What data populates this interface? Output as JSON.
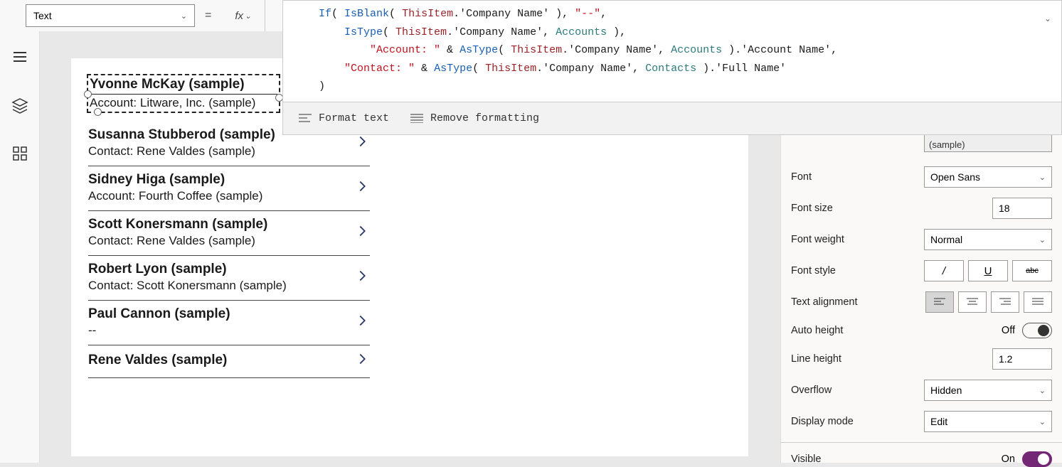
{
  "propertyDropdown": "Text",
  "fx": "fx",
  "formula": {
    "tokens": [
      [
        {
          "t": "If",
          "c": "tok-blue"
        },
        {
          "t": "( ",
          "c": "tok-text"
        },
        {
          "t": "IsBlank",
          "c": "tok-blue"
        },
        {
          "t": "( ",
          "c": "tok-text"
        },
        {
          "t": "ThisItem",
          "c": "tok-darkred"
        },
        {
          "t": ".'Company Name' ), ",
          "c": "tok-text"
        },
        {
          "t": "\"--\"",
          "c": "tok-red"
        },
        {
          "t": ",",
          "c": "tok-text"
        }
      ],
      [
        {
          "t": "    ",
          "c": "tok-text"
        },
        {
          "t": "IsType",
          "c": "tok-blue"
        },
        {
          "t": "( ",
          "c": "tok-text"
        },
        {
          "t": "ThisItem",
          "c": "tok-darkred"
        },
        {
          "t": ".'Company Name', ",
          "c": "tok-text"
        },
        {
          "t": "Accounts",
          "c": "tok-teal"
        },
        {
          "t": " ),",
          "c": "tok-text"
        }
      ],
      [
        {
          "t": "        ",
          "c": "tok-text"
        },
        {
          "t": "\"Account: \"",
          "c": "tok-red"
        },
        {
          "t": " & ",
          "c": "tok-text"
        },
        {
          "t": "AsType",
          "c": "tok-blue"
        },
        {
          "t": "( ",
          "c": "tok-text"
        },
        {
          "t": "ThisItem",
          "c": "tok-darkred"
        },
        {
          "t": ".'Company Name', ",
          "c": "tok-text"
        },
        {
          "t": "Accounts",
          "c": "tok-teal"
        },
        {
          "t": " ).'Account Name',",
          "c": "tok-text"
        }
      ],
      [
        {
          "t": "    ",
          "c": "tok-text"
        },
        {
          "t": "\"Contact: \"",
          "c": "tok-red"
        },
        {
          "t": " & ",
          "c": "tok-text"
        },
        {
          "t": "AsType",
          "c": "tok-blue"
        },
        {
          "t": "( ",
          "c": "tok-text"
        },
        {
          "t": "ThisItem",
          "c": "tok-darkred"
        },
        {
          "t": ".'Company Name', ",
          "c": "tok-text"
        },
        {
          "t": "Contacts",
          "c": "tok-teal"
        },
        {
          "t": " ).'Full Name'",
          "c": "tok-text"
        }
      ],
      [
        {
          "t": ")",
          "c": "tok-text"
        }
      ]
    ]
  },
  "formulaToolbar": {
    "format": "Format text",
    "remove": "Remove formatting"
  },
  "gallery": [
    {
      "title": "Yvonne McKay (sample)",
      "sub": "Account: Litware, Inc. (sample)",
      "selected": true
    },
    {
      "title": "Susanna Stubberod (sample)",
      "sub": "Contact: Rene Valdes (sample)"
    },
    {
      "title": "Sidney Higa (sample)",
      "sub": "Account: Fourth Coffee (sample)"
    },
    {
      "title": "Scott Konersmann (sample)",
      "sub": "Contact: Rene Valdes (sample)"
    },
    {
      "title": "Robert Lyon (sample)",
      "sub": "Contact: Scott Konersmann (sample)"
    },
    {
      "title": "Paul Cannon (sample)",
      "sub": "--"
    },
    {
      "title": "Rene Valdes (sample)",
      "sub": ""
    }
  ],
  "props": {
    "textValue": "(sample)",
    "font": {
      "label": "Font",
      "value": "Open Sans"
    },
    "fontSize": {
      "label": "Font size",
      "value": "18"
    },
    "fontWeight": {
      "label": "Font weight",
      "value": "Normal"
    },
    "fontStyle": {
      "label": "Font style",
      "italic": "/",
      "underline": "U",
      "strike": "abc"
    },
    "align": {
      "label": "Text alignment"
    },
    "autoHeight": {
      "label": "Auto height",
      "value": "Off"
    },
    "lineHeight": {
      "label": "Line height",
      "value": "1.2"
    },
    "overflow": {
      "label": "Overflow",
      "value": "Hidden"
    },
    "displayMode": {
      "label": "Display mode",
      "value": "Edit"
    },
    "visible": {
      "label": "Visible",
      "value": "On"
    }
  }
}
